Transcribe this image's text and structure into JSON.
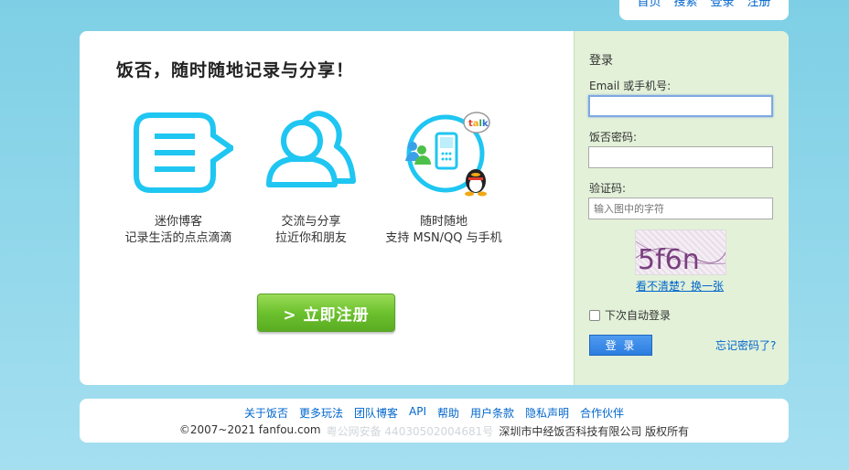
{
  "top_nav": {
    "items": [
      "首页",
      "搜索",
      "登录",
      "注册"
    ]
  },
  "headline": "饭否，随时随地记录与分享！",
  "features": [
    {
      "line1": "迷你博客",
      "line2": "记录生活的点点滴滴"
    },
    {
      "line1": "交流与分享",
      "line2": "拉近你和朋友"
    },
    {
      "line1": "随时随地",
      "line2": "支持 MSN/QQ 与手机"
    }
  ],
  "register_button": "> 立即注册",
  "login": {
    "title": "登录",
    "email_label": "Email 或手机号:",
    "email_value": "",
    "password_label": "饭否密码:",
    "password_value": "",
    "captcha_label": "验证码:",
    "captcha_placeholder": "输入图中的字符",
    "captcha_text": "5f6n",
    "captcha_refresh": "看不清楚？换一张",
    "remember": "下次自动登录",
    "remember_checked": false,
    "submit": "登 录",
    "forgot": "忘记密码了?"
  },
  "footer": {
    "links": [
      "关于饭否",
      "更多玩法",
      "团队博客",
      "API",
      "帮助",
      "用户条款",
      "隐私声明",
      "合作伙伴"
    ],
    "copyright": "©2007~2021 fanfou.com",
    "icp": "粤公网安备 44030502004681号",
    "company": "深圳市中经饭否科技有限公司 版权所有"
  },
  "colors": {
    "accent_cyan": "#1fc6f2",
    "link": "#0066cc",
    "register_green": "#6cc12e",
    "login_blue": "#2c7de0",
    "right_panel_bg": "#e3f1d9"
  }
}
